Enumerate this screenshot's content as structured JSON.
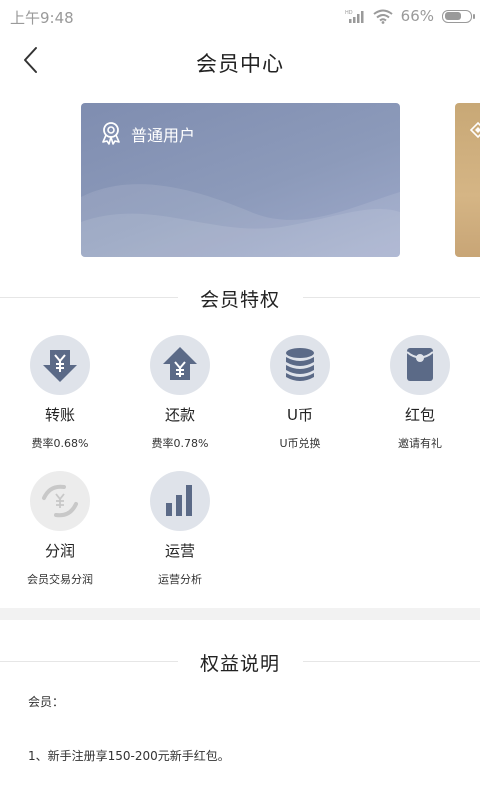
{
  "status_bar": {
    "time": "上午9:48",
    "battery": "66%",
    "icons": [
      "hd-signal-icon",
      "wifi-icon",
      "battery-icon"
    ]
  },
  "header": {
    "title": "会员中心",
    "back_icon": "chevron-left-icon"
  },
  "cards": {
    "current": {
      "label": "普通用户",
      "icon": "medal-icon"
    },
    "next_icon": "diamond-icon"
  },
  "privileges": {
    "title": "会员特权",
    "items": [
      {
        "name": "转账",
        "desc": "费率0.68%",
        "icon": "transfer-down-icon"
      },
      {
        "name": "还款",
        "desc": "费率0.78%",
        "icon": "repay-up-icon"
      },
      {
        "name": "U币",
        "desc": "U币兑换",
        "icon": "coin-stack-icon"
      },
      {
        "name": "红包",
        "desc": "邀请有礼",
        "icon": "red-envelope-icon"
      },
      {
        "name": "分润",
        "desc": "会员交易分润",
        "icon": "profit-share-icon"
      },
      {
        "name": "运营",
        "desc": "运营分析",
        "icon": "bar-chart-icon"
      }
    ]
  },
  "rights": {
    "title": "权益说明",
    "lines": [
      "会员：",
      "1、新手注册享150-200元新手红包。"
    ]
  },
  "colors": {
    "icon_primary": "#5b6a87",
    "icon_circle": "#dfe3ea",
    "card_main": "#8592b3",
    "card_gold": "#ccad7b"
  }
}
